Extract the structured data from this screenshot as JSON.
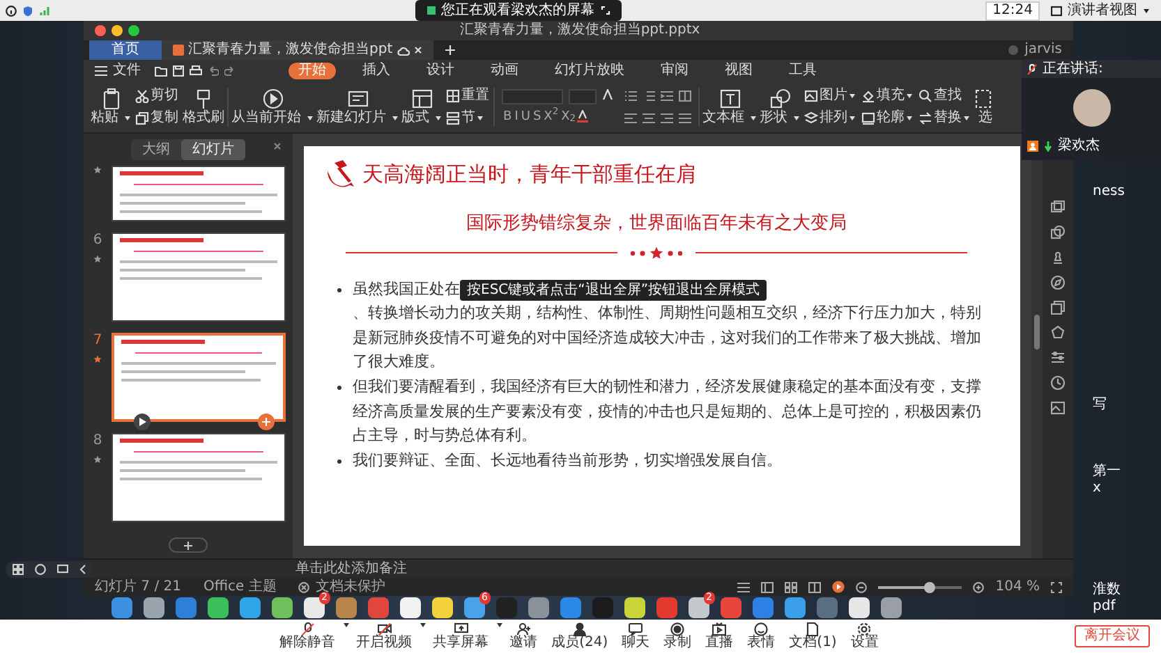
{
  "top_bar": {
    "viewing_notice": "您正在观看梁欢杰的屏幕",
    "time": "12:24",
    "view_button": "演讲者视图"
  },
  "window": {
    "title": "汇聚青春力量，激发使命担当ppt.pptx",
    "tabs": [
      {
        "kind": "home",
        "label": "首页",
        "selected": false
      },
      {
        "kind": "document",
        "label": "汇聚青春力量，激发使命担当ppt",
        "selected": true
      }
    ],
    "user": "jarvis",
    "file_menu": "文件",
    "menu_tabs": [
      {
        "label": "开始",
        "selected": true
      },
      {
        "label": "插入",
        "selected": false
      },
      {
        "label": "设计",
        "selected": false
      },
      {
        "label": "动画",
        "selected": false
      },
      {
        "label": "幻灯片放映",
        "selected": false
      },
      {
        "label": "审阅",
        "selected": false
      },
      {
        "label": "视图",
        "selected": false
      },
      {
        "label": "工具",
        "selected": false
      }
    ],
    "ribbon": [
      {
        "kind": "large",
        "label": "粘贴",
        "dropdown": true
      },
      {
        "kind": "pair",
        "items": [
          {
            "label": "剪切",
            "dropdown": false
          },
          {
            "label": "复制",
            "dropdown": false
          }
        ]
      },
      {
        "kind": "large",
        "label": "格式刷",
        "dropdown": false
      },
      {
        "kind": "separator"
      },
      {
        "kind": "large",
        "label": "从当前开始",
        "dropdown": true
      },
      {
        "kind": "large",
        "label": "新建幻灯片",
        "dropdown": true
      },
      {
        "kind": "large",
        "label": "版式",
        "dropdown": true
      },
      {
        "kind": "pair",
        "items": [
          {
            "label": "重置",
            "dropdown": false
          },
          {
            "label": "节",
            "dropdown": true
          }
        ]
      },
      {
        "kind": "separator"
      },
      {
        "kind": "font",
        "buttons": [
          "B",
          "I",
          "U",
          "S",
          "X$^{2}$",
          "X$_{2}$"
        ]
      },
      {
        "kind": "paragraph"
      },
      {
        "kind": "separator"
      },
      {
        "kind": "large",
        "label": "文本框",
        "dropdown": true
      },
      {
        "kind": "large",
        "label": "形状",
        "dropdown": true
      },
      {
        "kind": "pair",
        "items": [
          {
            "label": "图片",
            "dropdown": true
          },
          {
            "label": "排列",
            "dropdown": true
          }
        ]
      },
      {
        "kind": "pair",
        "items": [
          {
            "label": "填充",
            "dropdown": true
          },
          {
            "label": "轮廓",
            "dropdown": true
          }
        ]
      },
      {
        "kind": "pair",
        "items": [
          {
            "label": "查找",
            "dropdown": false
          },
          {
            "label": "替换",
            "dropdown": true
          }
        ]
      },
      {
        "kind": "large",
        "label": "选",
        "dropdown": false
      }
    ]
  },
  "panel": {
    "tabs": [
      {
        "label": "大纲",
        "selected": false
      },
      {
        "label": "幻灯片",
        "selected": true
      }
    ],
    "thumbnails": [
      {
        "selected": false
      },
      {
        "number": "6",
        "selected": false
      },
      {
        "number": "7",
        "selected": true
      },
      {
        "number": "8",
        "selected": false
      }
    ]
  },
  "slide": {
    "title": "天高海阔正当时，青年干部重任在肩",
    "subtitle": "国际形势错综复杂，世界面临百年未有之大变局",
    "bullets": [
      {
        "text": "虽然我国正处在",
        "tooltip": "按ESC键或者点击“退出全屏”按钮退出全屏模式",
        "text_after": "、转换增长动力的攻关期，结构性、体制性、周期性问题相互交织，经济下行压力加大，特别是新冠肺炎疫情不可避免的对中国经济造成较大冲击，这对我们的工作带来了极大挑战、增加了很大难度。"
      },
      {
        "text": "但我们要清醒看到，我国经济有巨大的韧性和潜力，经济发展健康稳定的基本面没有变，支撑经济高质量发展的生产要素没有变，疫情的冲击也只是短期的、总体上是可控的，积极因素仍占主导，时与势总体有利。"
      },
      {
        "text": "我们要辩证、全面、长远地看待当前形势，切实增强发展自信。"
      }
    ]
  },
  "notes": {
    "placeholder": "单击此处添加备注"
  },
  "status_bar": {
    "slide_counter": "幻灯片 7 / 21",
    "theme": "Office 主题",
    "protection": "文档未保护",
    "zoom": {
      "level": 0.62,
      "reading": "104 %"
    }
  },
  "video_tile": {
    "header": "正在讲话:",
    "name": "梁欢杰"
  },
  "desktop_labels": [
    "ness",
    "写",
    "第一",
    "x",
    "淮数",
    "pdf"
  ],
  "dock": [
    {
      "color": "#3d8fe0"
    },
    {
      "color": "#9aa4ad"
    },
    {
      "color": "#2f7fd8"
    },
    {
      "color": "#3bbf5a"
    },
    {
      "color": "#2ea6e8"
    },
    {
      "color": "#6fbf5c"
    },
    {
      "color": "#e9e9e9",
      "badge": "2"
    },
    {
      "color": "#b8864b"
    },
    {
      "color": "#e0473c"
    },
    {
      "color": "#f2f2f2"
    },
    {
      "color": "#f3d13a"
    },
    {
      "color": "#4aa3e8",
      "badge": "6"
    },
    {
      "color": "#222222"
    },
    {
      "color": "#8a9199"
    },
    {
      "color": "#2c88e6"
    },
    {
      "color": "#1c1c1c"
    },
    {
      "color": "#c9d33a"
    },
    {
      "color": "#e23a2f"
    },
    {
      "color": "#c5c9cc",
      "badge": "2"
    },
    {
      "color": "#e8453c"
    },
    {
      "color": "#2f80e4"
    },
    {
      "color": "#3a9ee8"
    },
    {
      "color": "#5a6e82"
    },
    {
      "color": "#e7e7e7"
    },
    {
      "color": "#9a9fa5"
    }
  ],
  "meeting_toolbar": {
    "items": [
      {
        "label": "解除静音",
        "dropdown": true
      },
      {
        "label": "开启视频",
        "dropdown": true
      },
      {
        "label": "共享屏幕",
        "dropdown": true
      },
      {
        "label": "邀请",
        "dropdown": false
      },
      {
        "label": "成员(24)",
        "dropdown": false
      },
      {
        "label": "聊天",
        "dropdown": false
      },
      {
        "label": "录制",
        "dropdown": false
      },
      {
        "label": "直播",
        "dropdown": false
      },
      {
        "label": "表情",
        "dropdown": false
      },
      {
        "label": "文档(1)",
        "dropdown": false
      },
      {
        "label": "设置",
        "dropdown": false
      }
    ],
    "leave_button": "离开会议"
  }
}
